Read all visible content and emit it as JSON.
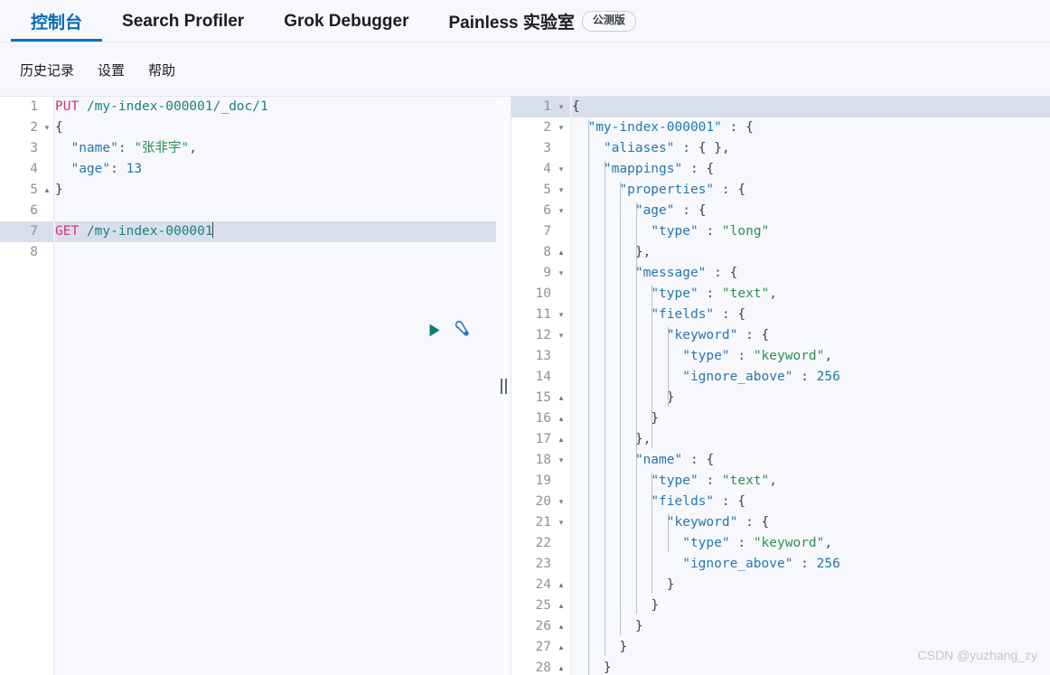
{
  "topnav": {
    "tabs": [
      {
        "label": "控制台",
        "active": true
      },
      {
        "label": "Search Profiler",
        "active": false
      },
      {
        "label": "Grok Debugger",
        "active": false
      },
      {
        "label": "Painless 实验室",
        "active": false
      }
    ],
    "badge": "公测版",
    "active_color": "#0b6ab4",
    "underline_color": "#0b72bb"
  },
  "subnav": {
    "links": [
      "历史记录",
      "设置",
      "帮助"
    ]
  },
  "request_editor": {
    "name": "console-request-editor",
    "highlighted_line": 7,
    "cursor_line": 7,
    "lines": [
      {
        "n": "1",
        "fold": "",
        "text": "PUT /my-index-000001/_doc/1"
      },
      {
        "n": "2",
        "fold": "▾",
        "text": "{"
      },
      {
        "n": "3",
        "fold": "",
        "text": "  \"name\": \"张非宇\","
      },
      {
        "n": "4",
        "fold": "",
        "text": "  \"age\": 13"
      },
      {
        "n": "5",
        "fold": "▴",
        "text": "}"
      },
      {
        "n": "6",
        "fold": "",
        "text": ""
      },
      {
        "n": "7",
        "fold": "",
        "text": "GET /my-index-000001"
      },
      {
        "n": "8",
        "fold": "",
        "text": ""
      }
    ],
    "actions": {
      "play": "play-icon",
      "wrench": "wrench-icon"
    }
  },
  "response_editor": {
    "name": "console-response-editor",
    "highlighted_line": 1,
    "lines": [
      {
        "n": "1",
        "fold": "▾",
        "text": "{"
      },
      {
        "n": "2",
        "fold": "▾",
        "text": "  \"my-index-000001\" : {"
      },
      {
        "n": "3",
        "fold": "",
        "text": "    \"aliases\" : { },"
      },
      {
        "n": "4",
        "fold": "▾",
        "text": "    \"mappings\" : {"
      },
      {
        "n": "5",
        "fold": "▾",
        "text": "      \"properties\" : {"
      },
      {
        "n": "6",
        "fold": "▾",
        "text": "        \"age\" : {"
      },
      {
        "n": "7",
        "fold": "",
        "text": "          \"type\" : \"long\""
      },
      {
        "n": "8",
        "fold": "▴",
        "text": "        },"
      },
      {
        "n": "9",
        "fold": "▾",
        "text": "        \"message\" : {"
      },
      {
        "n": "10",
        "fold": "",
        "text": "          \"type\" : \"text\","
      },
      {
        "n": "11",
        "fold": "▾",
        "text": "          \"fields\" : {"
      },
      {
        "n": "12",
        "fold": "▾",
        "text": "            \"keyword\" : {"
      },
      {
        "n": "13",
        "fold": "",
        "text": "              \"type\" : \"keyword\","
      },
      {
        "n": "14",
        "fold": "",
        "text": "              \"ignore_above\" : 256"
      },
      {
        "n": "15",
        "fold": "▴",
        "text": "            }"
      },
      {
        "n": "16",
        "fold": "▴",
        "text": "          }"
      },
      {
        "n": "17",
        "fold": "▴",
        "text": "        },"
      },
      {
        "n": "18",
        "fold": "▾",
        "text": "        \"name\" : {"
      },
      {
        "n": "19",
        "fold": "",
        "text": "          \"type\" : \"text\","
      },
      {
        "n": "20",
        "fold": "▾",
        "text": "          \"fields\" : {"
      },
      {
        "n": "21",
        "fold": "▾",
        "text": "            \"keyword\" : {"
      },
      {
        "n": "22",
        "fold": "",
        "text": "              \"type\" : \"keyword\","
      },
      {
        "n": "23",
        "fold": "",
        "text": "              \"ignore_above\" : 256"
      },
      {
        "n": "24",
        "fold": "▴",
        "text": "            }"
      },
      {
        "n": "25",
        "fold": "▴",
        "text": "          }"
      },
      {
        "n": "26",
        "fold": "▴",
        "text": "        }"
      },
      {
        "n": "27",
        "fold": "▴",
        "text": "      }"
      },
      {
        "n": "28",
        "fold": "▴",
        "text": "    }"
      }
    ]
  },
  "splitter": {
    "label": "panel-resize-handle"
  },
  "watermark": {
    "text": "CSDN @yuzhang_zy"
  }
}
